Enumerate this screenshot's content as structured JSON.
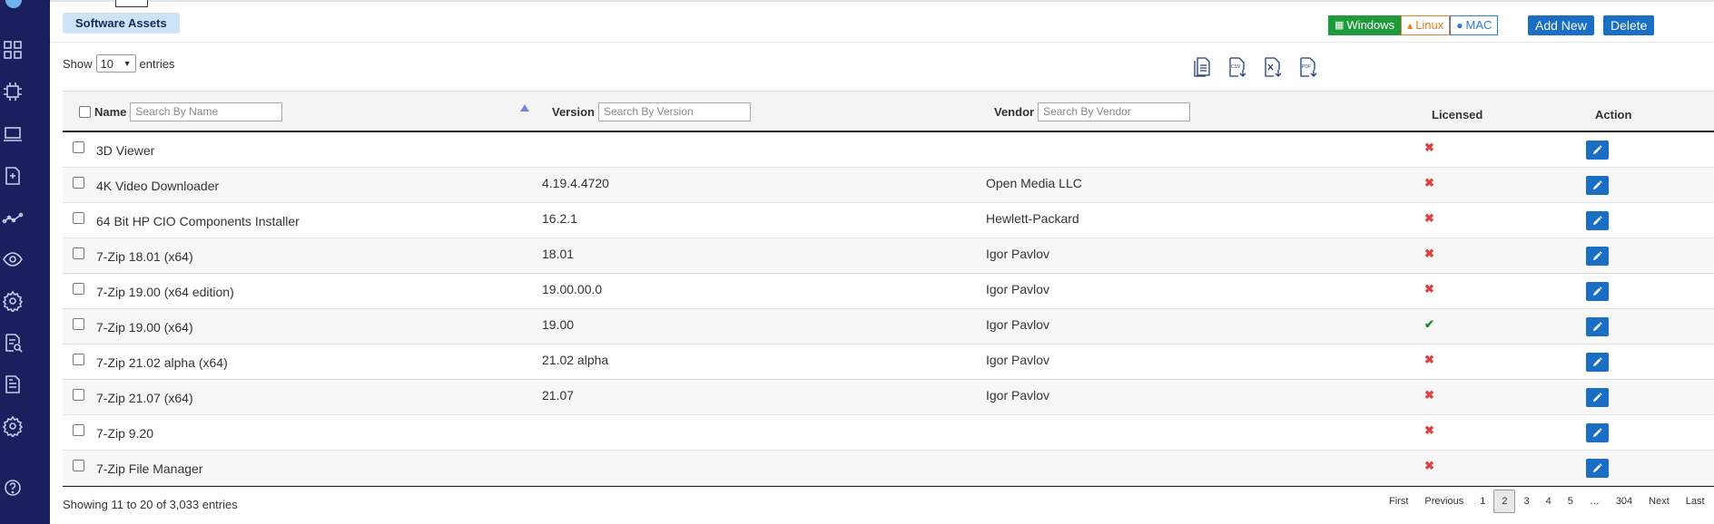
{
  "page": {
    "title": "Software Assets",
    "os_filters": [
      {
        "label": "Windows",
        "icon": "windows-icon"
      },
      {
        "label": "Linux",
        "icon": "linux-icon"
      },
      {
        "label": "MAC",
        "icon": "apple-icon"
      }
    ],
    "add_new_label": "Add New",
    "delete_label": "Delete"
  },
  "length_menu": {
    "show_label": "Show",
    "value": "10",
    "entries_label": "entries"
  },
  "export_buttons": [
    "copy-icon",
    "csv-icon",
    "excel-icon",
    "pdf-icon"
  ],
  "table": {
    "columns": {
      "name": "Name",
      "version": "Version",
      "vendor": "Vendor",
      "licensed": "Licensed",
      "action": "Action"
    },
    "placeholders": {
      "name": "Search By Name",
      "version": "Search By Version",
      "vendor": "Search By Vendor"
    },
    "rows": [
      {
        "name": "3D Viewer",
        "version": "",
        "vendor": "",
        "licensed": false
      },
      {
        "name": "4K Video Downloader",
        "version": "4.19.4.4720",
        "vendor": "Open Media LLC",
        "licensed": false
      },
      {
        "name": "64 Bit HP CIO Components Installer",
        "version": "16.2.1",
        "vendor": "Hewlett-Packard",
        "licensed": false
      },
      {
        "name": "7-Zip 18.01 (x64)",
        "version": "18.01",
        "vendor": "Igor Pavlov",
        "licensed": false
      },
      {
        "name": "7-Zip 19.00 (x64 edition)",
        "version": "19.00.00.0",
        "vendor": "Igor Pavlov",
        "licensed": false
      },
      {
        "name": "7-Zip 19.00 (x64)",
        "version": "19.00",
        "vendor": "Igor Pavlov",
        "licensed": true
      },
      {
        "name": "7-Zip 21.02 alpha (x64)",
        "version": "21.02 alpha",
        "vendor": "Igor Pavlov",
        "licensed": false
      },
      {
        "name": "7-Zip 21.07 (x64)",
        "version": "21.07",
        "vendor": "Igor Pavlov",
        "licensed": false
      },
      {
        "name": "7-Zip 9.20",
        "version": "",
        "vendor": "",
        "licensed": false
      },
      {
        "name": "7-Zip File Manager",
        "version": "",
        "vendor": "",
        "licensed": false
      }
    ],
    "licensed_glyphs": {
      "yes": "✔",
      "no": "✖"
    }
  },
  "info": "Showing 11 to 20 of 3,033 entries",
  "pagination": {
    "items": [
      "First",
      "Previous",
      "1",
      "2",
      "3",
      "4",
      "5",
      "…",
      "304",
      "Next",
      "Last"
    ],
    "current": "2"
  },
  "sidebar_icons": [
    "app-logo-icon",
    "dashboard-grid-icon",
    "chip-icon",
    "laptop-icon",
    "report-add-icon",
    "analytics-icon",
    "eye-icon",
    "settings-icon",
    "search-document-icon",
    "document-icon",
    "settings-alt-icon",
    "help-icon"
  ],
  "colors": {
    "sidebar": "#1b1f5e",
    "primary": "#1a6fc4",
    "windows": "#1f9a3a",
    "linux": "#e67e22",
    "mac": "#2a7bd2",
    "licensed_yes": "#1e8a2e",
    "licensed_no": "#e04040"
  }
}
